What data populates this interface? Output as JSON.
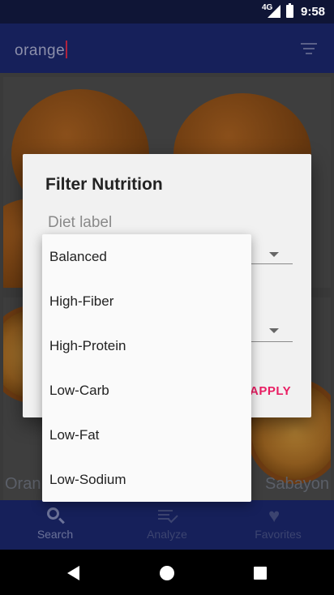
{
  "status_bar": {
    "network": "4G",
    "time": "9:58"
  },
  "app_bar": {
    "search_value": "orange",
    "filter_icon": "filter-list-icon"
  },
  "cards": [
    {
      "title_left": "Oran",
      "title_right": "Sabayon"
    }
  ],
  "bottom_nav": {
    "items": [
      {
        "label": "Search",
        "icon": "search-icon"
      },
      {
        "label": "Analyze",
        "icon": "analyze-icon"
      },
      {
        "label": "Favorites",
        "icon": "heart-icon"
      }
    ]
  },
  "dialog": {
    "title": "Filter Nutrition",
    "diet_label": "Diet label",
    "apply_label": "APPLY",
    "accent_color": "#e91e63"
  },
  "dropdown": {
    "options": [
      "Balanced",
      "High-Fiber",
      "High-Protein",
      "Low-Carb",
      "Low-Fat",
      "Low-Sodium"
    ]
  },
  "colors": {
    "primary": "#1a237e",
    "status_bar": "#0f1536"
  }
}
